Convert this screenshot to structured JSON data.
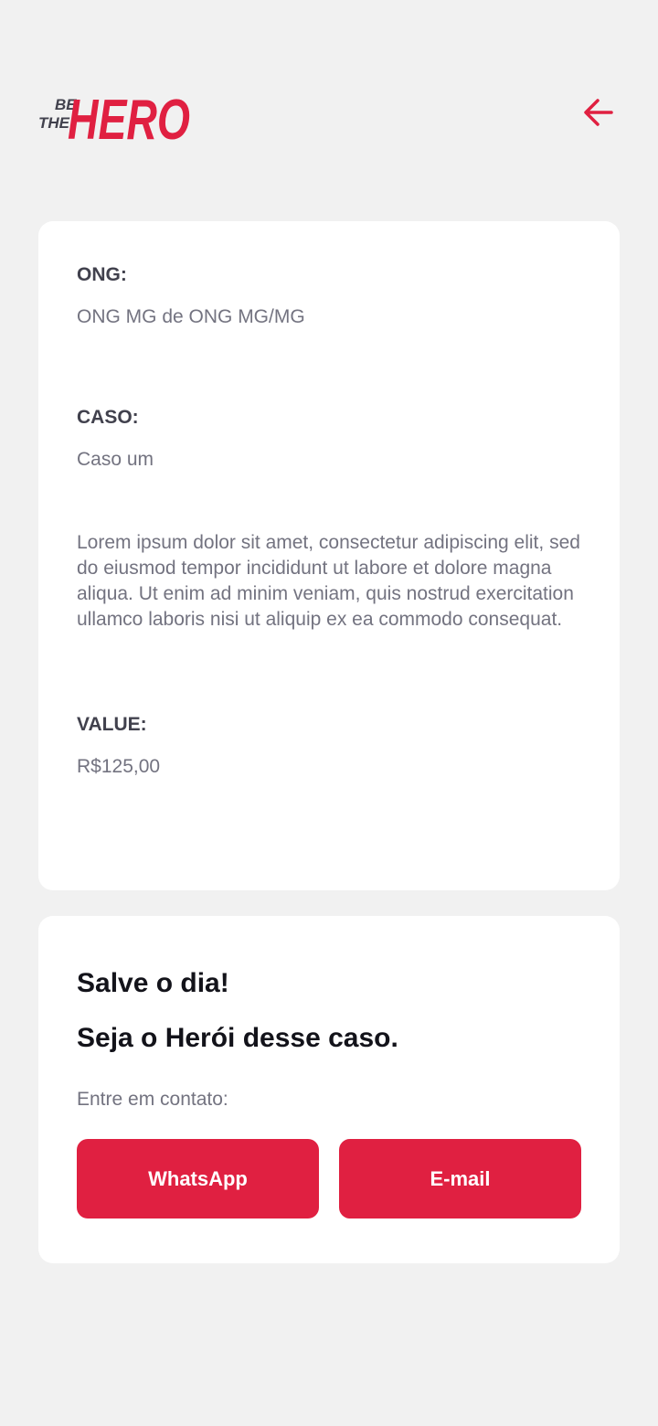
{
  "header": {
    "logo_text_small_1": "BE",
    "logo_text_small_2": "THE",
    "logo_text_big": "HERO",
    "back_icon": "arrow-left-icon",
    "brand_color": "#e02041"
  },
  "incident": {
    "ong_label": "ONG:",
    "ong_value": "ONG MG de ONG MG/MG",
    "case_label": "CASO:",
    "case_value": "Caso um",
    "description": "Lorem ipsum dolor sit amet, consectetur adipiscing elit, sed do eiusmod tempor incididunt ut labore et dolore magna aliqua. Ut enim ad minim veniam, quis nostrud exercitation ullamco laboris nisi ut aliquip ex ea commodo consequat.",
    "value_label": "VALUE:",
    "value_value": "R$125,00"
  },
  "contact": {
    "title_1": "Salve o dia!",
    "title_2": "Seja o Herói desse caso.",
    "hint": "Entre em contato:",
    "whatsapp_label": "WhatsApp",
    "email_label": "E-mail"
  }
}
